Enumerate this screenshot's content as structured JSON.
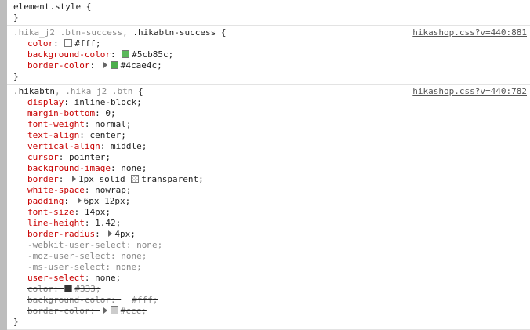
{
  "element_style": {
    "selector": "element.style {",
    "close": "}"
  },
  "rule1": {
    "selector_a": ".hika_j2 .btn-success, ",
    "selector_b": ".hikabtn-success",
    "open": " {",
    "source": "hikashop.css?v=440:881",
    "close": "}",
    "decls": [
      {
        "prop": "color",
        "value": "#fff",
        "swatch": "#ffffff"
      },
      {
        "prop": "background-color",
        "value": "#5cb85c",
        "swatch": "#5cb85c"
      },
      {
        "prop": "border-color",
        "value": "#4cae4c",
        "swatch": "#4cae4c"
      }
    ]
  },
  "rule2": {
    "selector_a": ".hikabtn",
    "selector_b": ", .hika_j2 .btn",
    "open": " {",
    "source": "hikashop.css?v=440:782",
    "decls": [
      {
        "prop": "display",
        "value": "inline-block"
      },
      {
        "prop": "margin-bottom",
        "value": "0"
      },
      {
        "prop": "font-weight",
        "value": "normal"
      },
      {
        "prop": "text-align",
        "value": "center"
      },
      {
        "prop": "vertical-align",
        "value": "middle"
      },
      {
        "prop": "cursor",
        "value": "pointer"
      },
      {
        "prop": "background-image",
        "value": "none"
      },
      {
        "prop": "border",
        "value_a": "1px solid ",
        "value_b": "transparent"
      },
      {
        "prop": "white-space",
        "value": "nowrap"
      },
      {
        "prop": "padding",
        "value": "6px 12px"
      },
      {
        "prop": "font-size",
        "value": "14px"
      },
      {
        "prop": "line-height",
        "value": "1.42"
      },
      {
        "prop": "border-radius",
        "value": "4px"
      },
      {
        "prop": "-webkit-user-select",
        "value": "none"
      },
      {
        "prop": "-moz-user-select",
        "value": "none"
      },
      {
        "prop": "-ms-user-select",
        "value": "none"
      },
      {
        "prop": "user-select",
        "value": "none"
      },
      {
        "prop": "color",
        "value": "#333",
        "swatch": "#333333"
      },
      {
        "prop": "background-color",
        "value": "#fff",
        "swatch": "#ffffff"
      },
      {
        "prop": "border-color",
        "value": "#ccc",
        "swatch": "#cccccc"
      }
    ],
    "close": "}"
  },
  "punct": {
    "colon": ": ",
    "semi": ";"
  }
}
